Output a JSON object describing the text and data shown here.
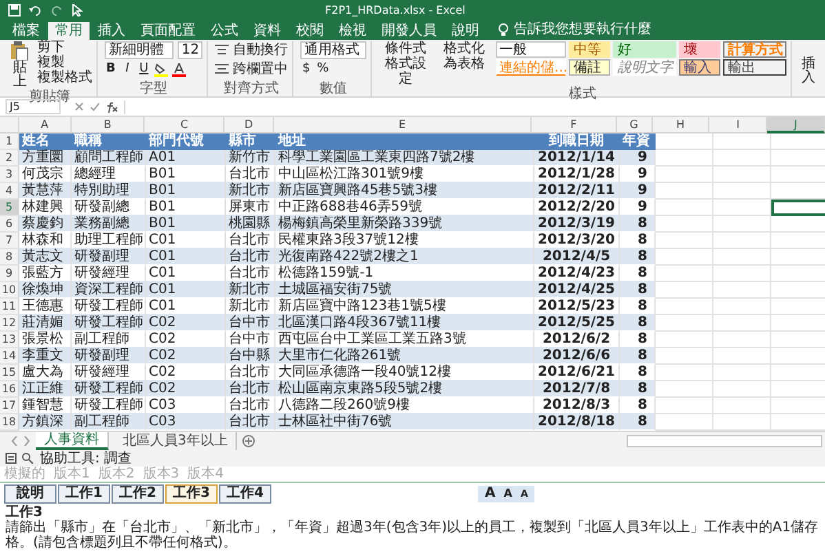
{
  "window": {
    "title": "F2P1_HRData.xlsx - Excel"
  },
  "menu_tabs": [
    {
      "label": "檔案",
      "selected": false
    },
    {
      "label": "常用",
      "selected": true
    },
    {
      "label": "插入",
      "selected": false
    },
    {
      "label": "頁面配置",
      "selected": false
    },
    {
      "label": "公式",
      "selected": false
    },
    {
      "label": "資料",
      "selected": false
    },
    {
      "label": "校閱",
      "selected": false
    },
    {
      "label": "檢視",
      "selected": false
    },
    {
      "label": "開發人員",
      "selected": false
    },
    {
      "label": "說明",
      "selected": false
    }
  ],
  "tell_me": "告訴我您想要執行什麼",
  "ribbon": {
    "clipboard": {
      "paste": "貼上",
      "items": [
        "剪下",
        "複製",
        "複製格式"
      ],
      "label": "剪貼簿"
    },
    "font": {
      "name": "新細明體",
      "size": "12",
      "format_buttons": [
        "B",
        "I",
        "U"
      ],
      "label": "字型"
    },
    "alignment": {
      "wrap": "自動換行",
      "merge": "跨欄置中",
      "label": "對齊方式"
    },
    "number": {
      "format": "通用格式",
      "symbols": [
        "$",
        "%"
      ],
      "label": "數值"
    },
    "styles": {
      "conditional": "條件式格式設定",
      "format_table": "格式化為表格",
      "label": "樣式",
      "cells": [
        {
          "label": "一般",
          "kind": "normal"
        },
        {
          "label": "中等",
          "kind": "neutral"
        },
        {
          "label": "好",
          "kind": "good"
        },
        {
          "label": "壞",
          "kind": "bad"
        },
        {
          "label": "計算方式",
          "kind": "calculation"
        },
        {
          "label": "連結的儲...",
          "kind": "linked"
        },
        {
          "label": "備註",
          "kind": "note"
        },
        {
          "label": "說明文字",
          "kind": "explanatory"
        },
        {
          "label": "輸入",
          "kind": "input"
        },
        {
          "label": "輸出",
          "kind": "output"
        }
      ]
    },
    "insert": "插入"
  },
  "formula_bar": {
    "name_box": "J5"
  },
  "columns": [
    {
      "letter": "A",
      "selected": false
    },
    {
      "letter": "B",
      "selected": false
    },
    {
      "letter": "C",
      "selected": false
    },
    {
      "letter": "D",
      "selected": false
    },
    {
      "letter": "E",
      "selected": false
    },
    {
      "letter": "F",
      "selected": false
    },
    {
      "letter": "G",
      "selected": false
    },
    {
      "letter": "H",
      "selected": false
    },
    {
      "letter": "I",
      "selected": false
    },
    {
      "letter": "J",
      "selected": true
    }
  ],
  "header_row": {
    "number": "1",
    "cells": [
      "姓名",
      "職稱",
      "部門代號",
      "縣市",
      "地址",
      "到職日期",
      "年資"
    ]
  },
  "rows": [
    {
      "number": "2",
      "active_cell": false,
      "cells": [
        "方重圜",
        "顧問工程師",
        "A01",
        "新竹市",
        "科學工業園區工業東四路7號2樓",
        "2012/1/14",
        "9"
      ]
    },
    {
      "number": "3",
      "active_cell": false,
      "cells": [
        "何茂宗",
        "總經理",
        "B01",
        "台北市",
        "中山區松江路301號9樓",
        "2012/1/28",
        "9"
      ]
    },
    {
      "number": "4",
      "active_cell": false,
      "cells": [
        "黃慧萍",
        "特別助理",
        "B01",
        "新北市",
        "新店區寶興路45巷5號3樓",
        "2012/2/11",
        "9"
      ]
    },
    {
      "number": "5",
      "active_cell": true,
      "cells": [
        "林建興",
        "研發副總",
        "B01",
        "屏東市",
        "中正路688巷46弄59號",
        "2012/2/20",
        "9"
      ]
    },
    {
      "number": "6",
      "active_cell": false,
      "cells": [
        "蔡慶鈞",
        "業務副總",
        "B01",
        "桃園縣",
        "楊梅鎮高榮里新榮路339號",
        "2012/3/19",
        "8"
      ]
    },
    {
      "number": "7",
      "active_cell": false,
      "cells": [
        "林森和",
        "助理工程師",
        "C01",
        "台北市",
        "民權東路3段37號12樓",
        "2012/3/20",
        "8"
      ]
    },
    {
      "number": "8",
      "active_cell": false,
      "cells": [
        "黃志文",
        "研發副理",
        "C01",
        "台北市",
        "光復南路422號2樓之1",
        "2012/4/5",
        "8"
      ]
    },
    {
      "number": "9",
      "active_cell": false,
      "cells": [
        "張藍方",
        "研發經理",
        "C01",
        "台北市",
        "松德路159號-1",
        "2012/4/23",
        "8"
      ]
    },
    {
      "number": "10",
      "active_cell": false,
      "cells": [
        "徐煥坤",
        "資深工程師",
        "C01",
        "新北市",
        "土城區福安街75號",
        "2012/4/25",
        "8"
      ]
    },
    {
      "number": "11",
      "active_cell": false,
      "cells": [
        "王德惠",
        "研發工程師",
        "C01",
        "新北市",
        "新店區寶中路123巷1號5樓",
        "2012/5/23",
        "8"
      ]
    },
    {
      "number": "12",
      "active_cell": false,
      "cells": [
        "莊清媚",
        "研發工程師",
        "C02",
        "台中市",
        "北區漢口路4段367號11樓",
        "2012/5/25",
        "8"
      ]
    },
    {
      "number": "13",
      "active_cell": false,
      "cells": [
        "張景松",
        "副工程師",
        "C02",
        "台中市",
        "西屯區台中工業區工業五路3號",
        "2012/6/2",
        "8"
      ]
    },
    {
      "number": "14",
      "active_cell": false,
      "cells": [
        "李重文",
        "研發副理",
        "C02",
        "台中縣",
        "大里市仁化路261號",
        "2012/6/6",
        "8"
      ]
    },
    {
      "number": "15",
      "active_cell": false,
      "cells": [
        "盧大為",
        "研發經理",
        "C02",
        "台北市",
        "大同區承德路一段40號12樓",
        "2012/6/21",
        "8"
      ]
    },
    {
      "number": "16",
      "active_cell": false,
      "cells": [
        "江正維",
        "研發工程師",
        "C02",
        "台北市",
        "松山區南京東路5段5號2樓",
        "2012/7/8",
        "8"
      ]
    },
    {
      "number": "17",
      "active_cell": false,
      "cells": [
        "鍾智慧",
        "研發工程師",
        "C03",
        "台北市",
        "八德路二段260號9樓",
        "2012/8/3",
        "8"
      ]
    },
    {
      "number": "18",
      "active_cell": false,
      "cells": [
        "方鎮深",
        "副工程師",
        "C03",
        "台北市",
        "士林區社中街76號",
        "2012/8/18",
        "8"
      ]
    }
  ],
  "sheet_tabs": [
    {
      "label": "人事資料",
      "selected": true
    },
    {
      "label": "北區人員3年以上",
      "selected": false
    }
  ],
  "accessibility": "協助工具: 調查",
  "versions": [
    "模擬的",
    "版本1",
    "版本2",
    "版本3",
    "版本4"
  ],
  "task_buttons": [
    {
      "label": "說明",
      "selected": false
    },
    {
      "label": "工作1",
      "selected": false
    },
    {
      "label": "工作2",
      "selected": false
    },
    {
      "label": "工作3",
      "selected": true
    },
    {
      "label": "工作4",
      "selected": false
    }
  ],
  "font_size_buttons": [
    {
      "label": "A",
      "kind": "large"
    },
    {
      "label": "A",
      "kind": "medium"
    },
    {
      "label": "A",
      "kind": "small"
    }
  ],
  "task": {
    "heading": "工作3",
    "text": "請篩出「縣市」在「台北市」、「新北市」，「年資」超過3年(包含3年)以上的員工，複製到「北區人員3年以上」工作表中的A1儲存格。(請包含標題列且不帶任何格式)。"
  }
}
